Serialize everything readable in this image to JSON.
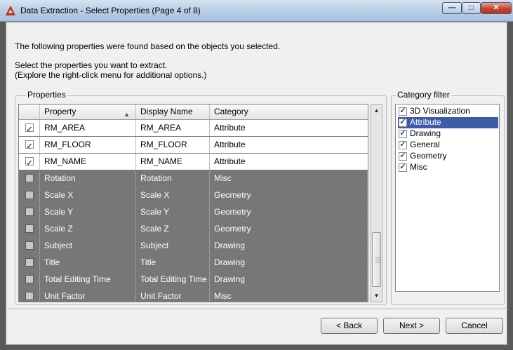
{
  "window": {
    "title": "Data Extraction - Select Properties (Page 4 of 8)",
    "controls": {
      "minimize": "—",
      "maximize": "□",
      "close": "✕"
    }
  },
  "intro": {
    "line1": "The following properties were found based on the objects you selected.",
    "line2": "Select the properties you want to extract.",
    "line3": "(Explore the right-click menu for additional options.)"
  },
  "properties": {
    "group_label": "Properties",
    "columns": {
      "property": "Property",
      "display_name": "Display Name",
      "category": "Category"
    },
    "sort_indicator": "▲",
    "rows": [
      {
        "checked": true,
        "property": "RM_AREA",
        "display_name": "RM_AREA",
        "category": "Attribute"
      },
      {
        "checked": true,
        "property": "RM_FLOOR",
        "display_name": "RM_FLOOR",
        "category": "Attribute"
      },
      {
        "checked": true,
        "property": "RM_NAME",
        "display_name": "RM_NAME",
        "category": "Attribute"
      },
      {
        "checked": false,
        "property": "Rotation",
        "display_name": "Rotation",
        "category": "Misc"
      },
      {
        "checked": false,
        "property": "Scale X",
        "display_name": "Scale X",
        "category": "Geometry"
      },
      {
        "checked": false,
        "property": "Scale Y",
        "display_name": "Scale Y",
        "category": "Geometry"
      },
      {
        "checked": false,
        "property": "Scale Z",
        "display_name": "Scale Z",
        "category": "Geometry"
      },
      {
        "checked": false,
        "property": "Subject",
        "display_name": "Subject",
        "category": "Drawing"
      },
      {
        "checked": false,
        "property": "Title",
        "display_name": "Title",
        "category": "Drawing"
      },
      {
        "checked": false,
        "property": "Total Editing Time",
        "display_name": "Total Editing Time",
        "category": "Drawing"
      },
      {
        "checked": false,
        "property": "Unit Factor",
        "display_name": "Unit Factor",
        "category": "Misc"
      }
    ],
    "scroll": {
      "up": "▲",
      "down": "▼"
    }
  },
  "category_filter": {
    "group_label": "Category filter",
    "items": [
      {
        "label": "3D Visualization",
        "checked": true,
        "selected": false
      },
      {
        "label": "Attribute",
        "checked": true,
        "selected": true
      },
      {
        "label": "Drawing",
        "checked": true,
        "selected": false
      },
      {
        "label": "General",
        "checked": true,
        "selected": false
      },
      {
        "label": "Geometry",
        "checked": true,
        "selected": false
      },
      {
        "label": "Misc",
        "checked": true,
        "selected": false
      }
    ]
  },
  "buttons": {
    "back": "< Back",
    "next": "Next >",
    "cancel": "Cancel"
  },
  "checkmark_glyph": "✓",
  "colors": {
    "checked_row": "#ffffff",
    "unchecked_row": "#777777",
    "selection": "#3d5ba9",
    "dialog_frame": "#5a5a5a"
  }
}
